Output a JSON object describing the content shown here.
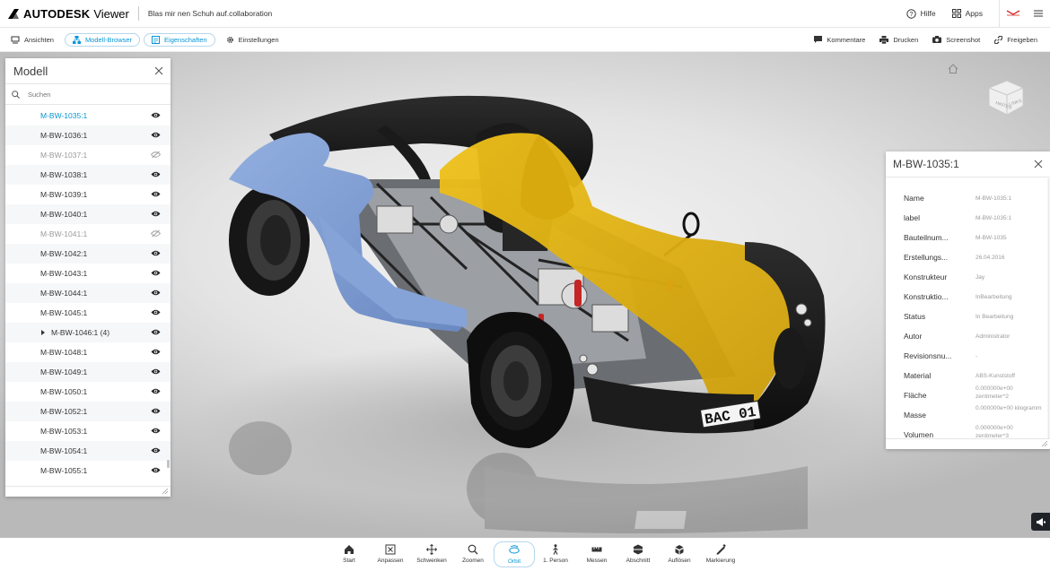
{
  "header": {
    "brand": "AUTODESK",
    "app": "Viewer",
    "document_title": "Blas mir nen Schuh auf.collaboration",
    "help": "Hilfe",
    "apps": "Apps"
  },
  "toolbar": {
    "left": [
      {
        "label": "Ansichten",
        "icon": "monitor-icon"
      },
      {
        "label": "Modell-Browser",
        "icon": "hierarchy-icon",
        "active": true
      },
      {
        "label": "Eigenschaften",
        "icon": "properties-icon",
        "active": true
      },
      {
        "label": "Einstellungen",
        "icon": "gear-icon"
      }
    ],
    "right": [
      {
        "label": "Kommentare",
        "icon": "comment-icon"
      },
      {
        "label": "Drucken",
        "icon": "printer-icon"
      },
      {
        "label": "Screenshot",
        "icon": "camera-icon"
      },
      {
        "label": "Freigeben",
        "icon": "link-icon"
      }
    ]
  },
  "model_browser": {
    "title": "Modell",
    "search_placeholder": "Suchen",
    "items": [
      {
        "label": "M-BW-1035:1",
        "state": "selected"
      },
      {
        "label": "M-BW-1036:1",
        "state": "visible"
      },
      {
        "label": "M-BW-1037:1",
        "state": "hidden"
      },
      {
        "label": "M-BW-1038:1",
        "state": "visible"
      },
      {
        "label": "M-BW-1039:1",
        "state": "visible"
      },
      {
        "label": "M-BW-1040:1",
        "state": "visible"
      },
      {
        "label": "M-BW-1041:1",
        "state": "hidden"
      },
      {
        "label": "M-BW-1042:1",
        "state": "visible"
      },
      {
        "label": "M-BW-1043:1",
        "state": "visible"
      },
      {
        "label": "M-BW-1044:1",
        "state": "visible"
      },
      {
        "label": "M-BW-1045:1",
        "state": "visible"
      },
      {
        "label": "M-BW-1046:1 (4)",
        "state": "visible",
        "expandable": true
      },
      {
        "label": "M-BW-1048:1",
        "state": "visible"
      },
      {
        "label": "M-BW-1049:1",
        "state": "visible"
      },
      {
        "label": "M-BW-1050:1",
        "state": "visible"
      },
      {
        "label": "M-BW-1052:1",
        "state": "visible"
      },
      {
        "label": "M-BW-1053:1",
        "state": "visible"
      },
      {
        "label": "M-BW-1054:1",
        "state": "visible"
      },
      {
        "label": "M-BW-1055:1",
        "state": "visible"
      }
    ]
  },
  "properties": {
    "title": "M-BW-1035:1",
    "rows": [
      {
        "name": "Name",
        "value": "M-BW-1035:1"
      },
      {
        "name": "label",
        "value": "M-BW-1035:1"
      },
      {
        "name": "Bauteilnum...",
        "value": "M-BW-1035"
      },
      {
        "name": "Erstellungs...",
        "value": "26.04.2016"
      },
      {
        "name": "Konstrukteur",
        "value": "Jay"
      },
      {
        "name": "Konstruktio...",
        "value": "InBearbeitung"
      },
      {
        "name": "Status",
        "value": "In Bearbeitung"
      },
      {
        "name": "Autor",
        "value": "Administrator"
      },
      {
        "name": "Revisionsnu...",
        "value": "-"
      },
      {
        "name": "Material",
        "value": "ABS-Kunststoff"
      },
      {
        "name": "Fläche",
        "value": "0.000000e+00 zentimeter^2"
      },
      {
        "name": "Masse",
        "value": "0.000000e+00 kilogramm"
      },
      {
        "name": "Volumen",
        "value": "0.000000e+00 zentimeter^3"
      }
    ]
  },
  "viewcube": {
    "front": "LINKS",
    "side": "HINTEN"
  },
  "model_scene": {
    "license_plate": "BAC 01"
  },
  "navigation": {
    "tools": [
      {
        "label": "Start",
        "icon": "home-icon"
      },
      {
        "label": "Anpassen",
        "icon": "fit-icon"
      },
      {
        "label": "Schwenken",
        "icon": "pan-icon"
      },
      {
        "label": "Zoomen",
        "icon": "zoom-icon"
      },
      {
        "label": "Orbit",
        "icon": "orbit-icon",
        "active": true
      },
      {
        "label": "1. Person",
        "icon": "person-icon"
      },
      {
        "label": "Messen",
        "icon": "measure-icon"
      },
      {
        "label": "Abschnitt",
        "icon": "section-icon"
      },
      {
        "label": "Auflösen",
        "icon": "explode-icon"
      },
      {
        "label": "Markierung",
        "icon": "markup-icon"
      }
    ]
  },
  "colors": {
    "accent": "#0696d7",
    "selection_blue": "#7f9ed2",
    "highlight_yellow": "#e7b712"
  }
}
